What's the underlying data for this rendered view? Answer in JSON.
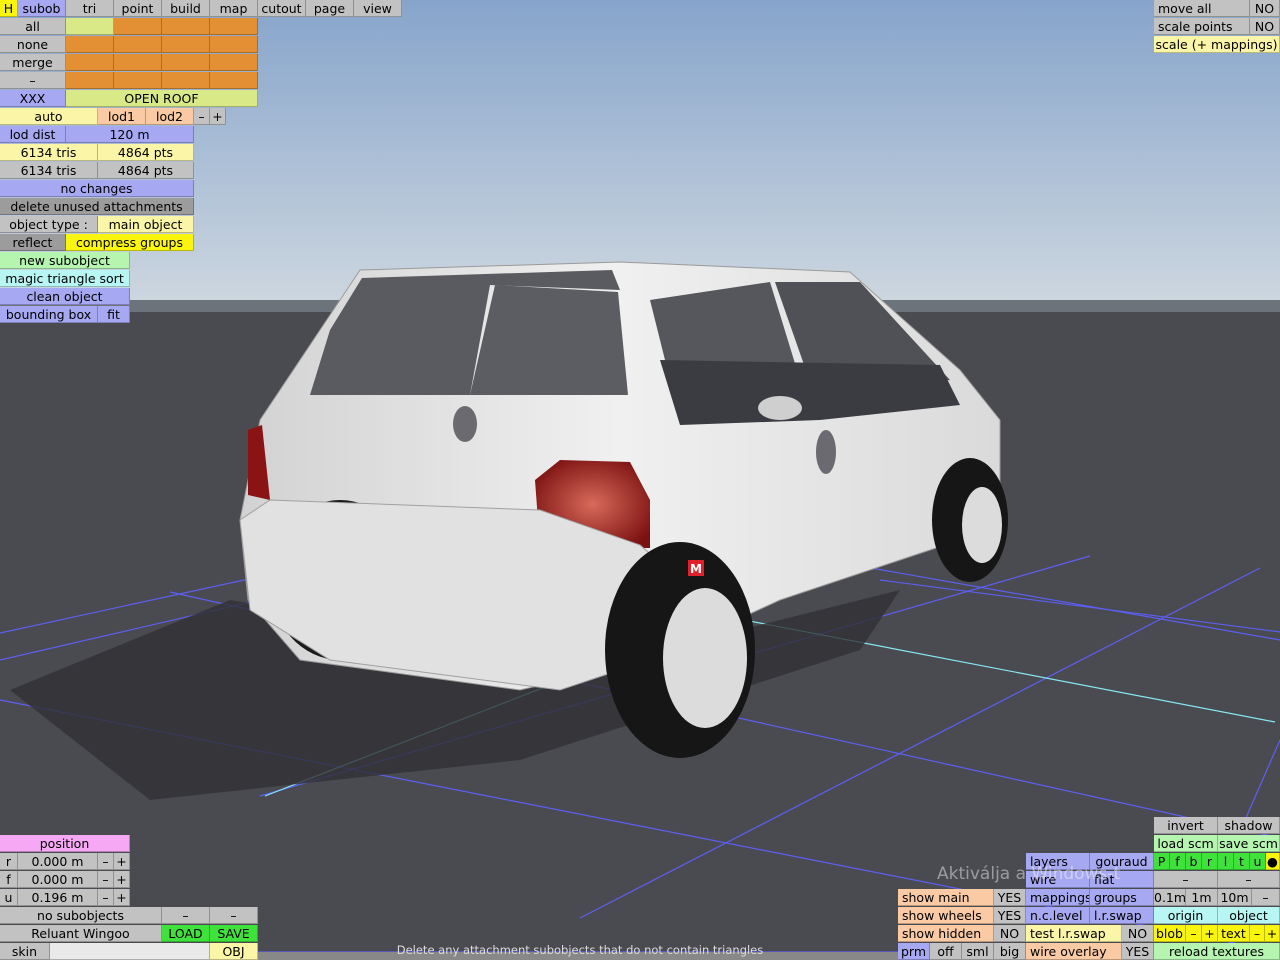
{
  "menu": {
    "h": "H",
    "tabs": [
      "subob",
      "tri",
      "point",
      "build",
      "map",
      "cutout",
      "page",
      "view"
    ]
  },
  "subobject_panel": {
    "select_all": "all",
    "select_none": "none",
    "merge": "merge",
    "minus": "–",
    "name_tag": "XXX",
    "name": "OPEN ROOF",
    "auto": "auto",
    "lod1": "lod1",
    "lod2": "lod2",
    "minus_btn": "–",
    "plus_btn": "+",
    "lod_dist_label": "lod dist",
    "lod_dist_value": "120 m",
    "tris_1": "6134 tris",
    "pts_1": "4864 pts",
    "tris_2": "6134 tris",
    "pts_2": "4864 pts",
    "no_changes": "no changes",
    "delete_unused": "delete unused attachments",
    "object_type_label": "object type :",
    "object_type_value": "main object",
    "reflect": "reflect",
    "compress_groups": "compress groups",
    "new_subobject": "new subobject",
    "magic_sort": "magic triangle sort",
    "clean_object": "clean object",
    "bounding_box": "bounding box",
    "fit": "fit"
  },
  "top_right": {
    "move_all": "move all",
    "move_all_val": "NO",
    "scale_points": "scale points",
    "scale_points_val": "NO",
    "scale_mappings": "scale (+ mappings)"
  },
  "position_panel": {
    "title": "position",
    "rows": [
      {
        "axis": "r",
        "value": "0.000 m"
      },
      {
        "axis": "f",
        "value": "0.000 m"
      },
      {
        "axis": "u",
        "value": "0.196 m"
      }
    ],
    "minus": "–",
    "plus": "+",
    "no_subobjects": "no subobjects",
    "car_name": "Reluant Wingoo",
    "load": "LOAD",
    "save": "SAVE",
    "skin": "skin",
    "obj": "OBJ"
  },
  "bottom_right": {
    "invert": "invert",
    "shadow": "shadow",
    "load_scm": "load scm",
    "save_scm": "save scm",
    "layers": "layers",
    "gouraud": "gouraud",
    "view_letters": [
      "P",
      "f",
      "b",
      "r",
      "l",
      "t",
      "u",
      "●"
    ],
    "wire": "wire",
    "flat": "flat",
    "minus": "–",
    "mappings": "mappings",
    "groups": "groups",
    "grid_sizes": [
      "0.1m",
      "1m",
      "10m"
    ],
    "show_main": "show main",
    "show_main_val": "YES",
    "show_wheels": "show wheels",
    "show_wheels_val": "YES",
    "show_hidden": "show hidden",
    "show_hidden_val": "NO",
    "nc_level": "n.c.level",
    "lr_swap": "l.r.swap",
    "origin": "origin",
    "object": "object",
    "test_lr_swap": "test l.r.swap",
    "test_lr_swap_val": "NO",
    "blob": "blob",
    "text": "text",
    "plus": "+",
    "prm": "prm",
    "off": "off",
    "sml": "sml",
    "big": "big",
    "wire_overlay": "wire overlay",
    "wire_overlay_val": "YES",
    "reload_textures": "reload textures"
  },
  "watermark": "Aktiválja a Windows-t",
  "status_text": "Delete any attachment subobjects that do not contain triangles",
  "badge_letter": "M",
  "colors": {
    "sky_top": "#87a6cc",
    "sky_bottom": "#c8d4df",
    "ground": "#4a4a52",
    "grid_blue": "#5a5cf0",
    "grid_cyan": "#7fe6f0",
    "car_body": "#e6e6e6",
    "badge": "#e0202a"
  }
}
